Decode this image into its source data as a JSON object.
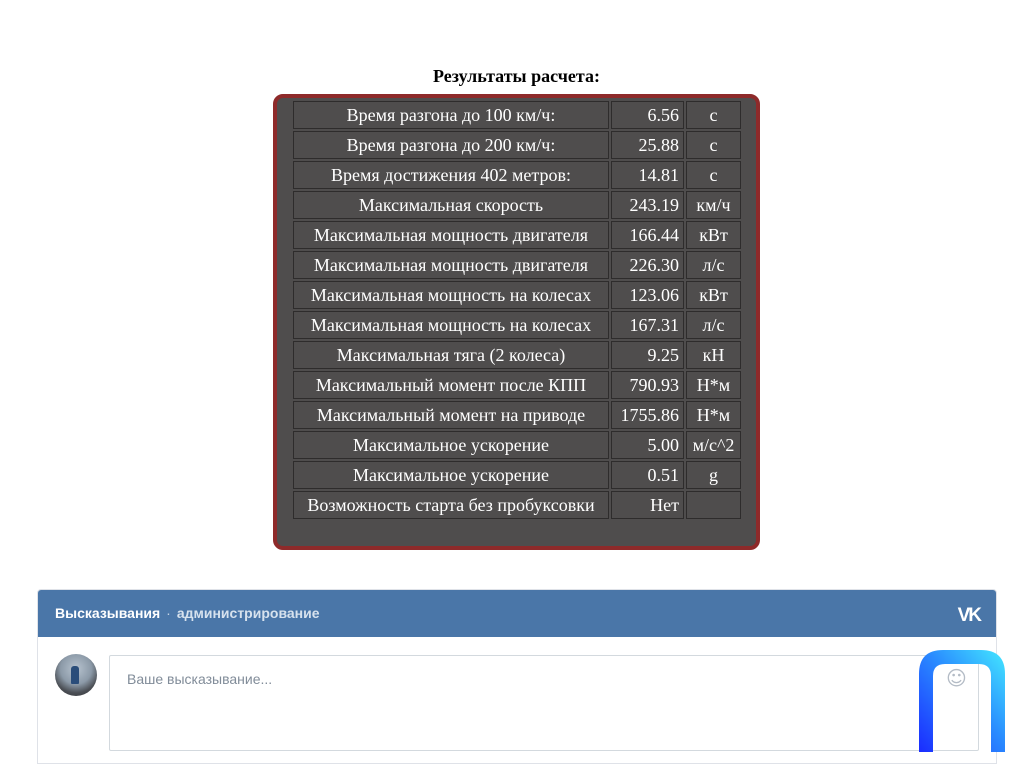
{
  "results": {
    "title": "Результаты расчета:",
    "rows": [
      {
        "label": "Время разгона до 100 км/ч:",
        "value": "6.56",
        "unit": "с"
      },
      {
        "label": "Время разгона до 200 км/ч:",
        "value": "25.88",
        "unit": "с"
      },
      {
        "label": "Время достижения 402 метров:",
        "value": "14.81",
        "unit": "с"
      },
      {
        "label": "Максимальная скорость",
        "value": "243.19",
        "unit": "км/ч"
      },
      {
        "label": "Максимальная мощность двигателя",
        "value": "166.44",
        "unit": "кВт"
      },
      {
        "label": "Максимальная мощность двигателя",
        "value": "226.30",
        "unit": "л/с"
      },
      {
        "label": "Максимальная мощность на колесах",
        "value": "123.06",
        "unit": "кВт"
      },
      {
        "label": "Максимальная мощность на колесах",
        "value": "167.31",
        "unit": "л/с"
      },
      {
        "label": "Максимальная тяга (2 колеса)",
        "value": "9.25",
        "unit": "кН"
      },
      {
        "label": "Максимальный момент после КПП",
        "value": "790.93",
        "unit": "Н*м"
      },
      {
        "label": "Максимальный момент на приводе",
        "value": "1755.86",
        "unit": "Н*м"
      },
      {
        "label": "Максимальное ускорение",
        "value": "5.00",
        "unit": "м/с^2"
      },
      {
        "label": "Максимальное ускорение",
        "value": "0.51",
        "unit": "g"
      },
      {
        "label": "Возможность старта без пробуксовки",
        "value": "Нет",
        "unit": ""
      }
    ]
  },
  "vk_widget": {
    "title": "Высказывания",
    "separator": "·",
    "admin_link": "администрирование",
    "logo_icon": "vk-logo-icon",
    "logo_text": "VK",
    "input_placeholder": "Ваше высказывание...",
    "smile_icon": "emoji-smile-icon",
    "smile_glyph": "☺",
    "header_color": "#4a76a8"
  },
  "colors": {
    "panel_border": "#8e2a2a",
    "panel_bg": "#4f4d4d"
  }
}
